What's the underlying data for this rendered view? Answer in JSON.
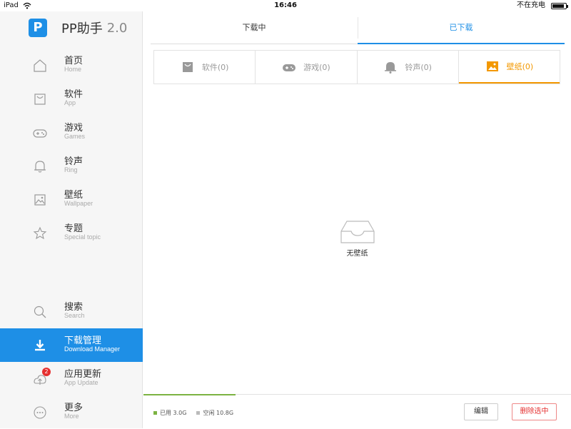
{
  "status_bar": {
    "device": "iPad",
    "time": "16:46",
    "charging": "不在充电",
    "battery_level": 0.9
  },
  "app": {
    "name": "PP助手",
    "version": "2.0",
    "logo_letter": "P",
    "accent": "#1e8fe6",
    "highlight": "#f39800"
  },
  "sidebar": {
    "items": [
      {
        "title": "首页",
        "sub": "Home",
        "icon": "home-icon"
      },
      {
        "title": "软件",
        "sub": "App",
        "icon": "bag-icon"
      },
      {
        "title": "游戏",
        "sub": "Games",
        "icon": "gamepad-icon"
      },
      {
        "title": "铃声",
        "sub": "Ring",
        "icon": "bell-icon"
      },
      {
        "title": "壁纸",
        "sub": "Wallpaper",
        "icon": "image-icon"
      },
      {
        "title": "专题",
        "sub": "Special topic",
        "icon": "star-icon"
      }
    ],
    "bottom_items": [
      {
        "title": "搜索",
        "sub": "Search",
        "icon": "search-icon"
      },
      {
        "title": "下载管理",
        "sub": "Download Manager",
        "icon": "download-icon",
        "active": true
      },
      {
        "title": "应用更新",
        "sub": "App Update",
        "icon": "update-icon",
        "badge": "2"
      },
      {
        "title": "更多",
        "sub": "More",
        "icon": "more-icon"
      }
    ]
  },
  "main": {
    "top_tabs": [
      {
        "label": "下载中"
      },
      {
        "label": "已下载",
        "active": true
      }
    ],
    "categories": [
      {
        "label": "软件(0)",
        "icon": "bag-icon"
      },
      {
        "label": "游戏(0)",
        "icon": "gamepad-icon"
      },
      {
        "label": "铃声(0)",
        "icon": "bell-icon"
      },
      {
        "label": "壁纸(0)",
        "icon": "image-icon",
        "active": true
      }
    ],
    "empty_text": "无壁纸"
  },
  "footer": {
    "used_label": "已用 3.0G",
    "free_label": "空闲 10.8G",
    "used_color": "#7cb342",
    "free_color": "#bbbbbb",
    "used_fraction": 0.215,
    "edit_label": "编辑",
    "delete_label": "删除选中"
  }
}
